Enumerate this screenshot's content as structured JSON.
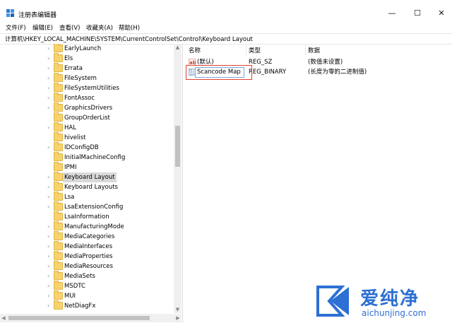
{
  "window": {
    "title": "注册表编辑器",
    "min_glyph": "—",
    "max_glyph": "☐",
    "close_glyph": "✕"
  },
  "menu": [
    "文件(F)",
    "编辑(E)",
    "查看(V)",
    "收藏夹(A)",
    "帮助(H)"
  ],
  "address": "计算机\\HKEY_LOCAL_MACHINE\\SYSTEM\\CurrentControlSet\\Control\\Keyboard Layout",
  "tree": {
    "selected": "Keyboard Layout",
    "items": [
      "EarlyLaunch",
      "Els",
      "Errata",
      "FileSystem",
      "FileSystemUtilities",
      "FontAssoc",
      "GraphicsDrivers",
      "GroupOrderList",
      "HAL",
      "hivelist",
      "IDConfigDB",
      "InitialMachineConfig",
      "IPMI",
      "Keyboard Layout",
      "Keyboard Layouts",
      "Lsa",
      "LsaExtensionConfig",
      "LsaInformation",
      "ManufacturingMode",
      "MediaCategories",
      "MediaInterfaces",
      "MediaProperties",
      "MediaResources",
      "MediaSets",
      "MSDTC",
      "MUI",
      "NetDiagFx"
    ]
  },
  "columns": {
    "name": "名称",
    "type": "类型",
    "data": "数据"
  },
  "values": [
    {
      "name": "(默认)",
      "type": "REG_SZ",
      "data": "(数值未设置)",
      "icon": "ab-string-icon"
    },
    {
      "name": "Scancode Map",
      "type": "REG_BINARY",
      "data": "(长度为零的二进制值)",
      "icon": "binary-value-icon"
    }
  ],
  "watermark": {
    "brand": "爱纯净",
    "url": "aichunjing.com",
    "color": "#2d6fd4"
  }
}
